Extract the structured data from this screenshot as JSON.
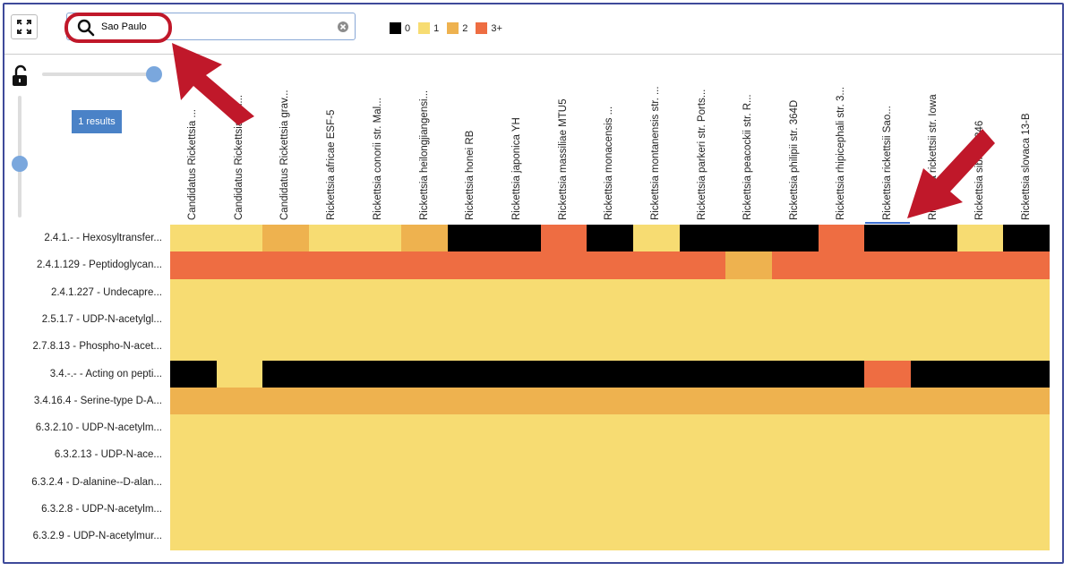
{
  "search": {
    "value": "Sao Paulo"
  },
  "legend": [
    {
      "label": "0",
      "color": "#000000"
    },
    {
      "label": "1",
      "color": "#f7dc72"
    },
    {
      "label": "2",
      "color": "#eeb24f"
    },
    {
      "label": "3+",
      "color": "#ee6d42"
    }
  ],
  "results_badge": "1 results",
  "columns": [
    "Candidatus Rickettsia ...",
    "Candidatus Rickettsia am...",
    "Candidatus Rickettsia grav...",
    "Rickettsia africae ESF-5",
    "Rickettsia conorii str. Mal...",
    "Rickettsia heilongjiangensi...",
    "Rickettsia honei RB",
    "Rickettsia japonica YH",
    "Rickettsia massiliae MTU5",
    "Rickettsia monacensis ...",
    "Rickettsia montanensis str. ...",
    "Rickettsia parkeri str. Ports...",
    "Rickettsia peacockii str. R...",
    "Rickettsia philipii str. 364D",
    "Rickettsia rhipicephali str. 3...",
    "Rickettsia rickettsii Sao...",
    "Rickettsia rickettsii str. Iowa",
    "Rickettsia sibirica 246",
    "Rickettsia slovaca 13-B"
  ],
  "rows": [
    {
      "label": "2.4.1.- - Hexosyltransfer...",
      "values": [
        1,
        1,
        2,
        1,
        1,
        2,
        0,
        0,
        3,
        0,
        1,
        0,
        0,
        0,
        3,
        0,
        0,
        1,
        0
      ]
    },
    {
      "label": "2.4.1.129 - Peptidoglycan...",
      "values": [
        3,
        3,
        3,
        3,
        3,
        3,
        3,
        3,
        3,
        3,
        3,
        3,
        2,
        3,
        3,
        3,
        3,
        3,
        3
      ]
    },
    {
      "label": "2.4.1.227 - Undecapre...",
      "values": [
        1,
        1,
        1,
        1,
        1,
        1,
        1,
        1,
        1,
        1,
        1,
        1,
        1,
        1,
        1,
        1,
        1,
        1,
        1
      ]
    },
    {
      "label": "2.5.1.7 - UDP-N-acetylgl...",
      "values": [
        1,
        1,
        1,
        1,
        1,
        1,
        1,
        1,
        1,
        1,
        1,
        1,
        1,
        1,
        1,
        1,
        1,
        1,
        1
      ]
    },
    {
      "label": "2.7.8.13 - Phospho-N-acet...",
      "values": [
        1,
        1,
        1,
        1,
        1,
        1,
        1,
        1,
        1,
        1,
        1,
        1,
        1,
        1,
        1,
        1,
        1,
        1,
        1
      ]
    },
    {
      "label": "3.4.-.- - Acting on pepti...",
      "values": [
        0,
        1,
        0,
        0,
        0,
        0,
        0,
        0,
        0,
        0,
        0,
        0,
        0,
        0,
        0,
        3,
        0,
        0,
        0
      ]
    },
    {
      "label": "3.4.16.4 - Serine-type D-A...",
      "values": [
        2,
        2,
        2,
        2,
        2,
        2,
        2,
        2,
        2,
        2,
        2,
        2,
        2,
        2,
        2,
        2,
        2,
        2,
        2
      ]
    },
    {
      "label": "6.3.2.10 - UDP-N-acetylm...",
      "values": [
        1,
        1,
        1,
        1,
        1,
        1,
        1,
        1,
        1,
        1,
        1,
        1,
        1,
        1,
        1,
        1,
        1,
        1,
        1
      ]
    },
    {
      "label": "6.3.2.13 - UDP-N-ace...",
      "values": [
        1,
        1,
        1,
        1,
        1,
        1,
        1,
        1,
        1,
        1,
        1,
        1,
        1,
        1,
        1,
        1,
        1,
        1,
        1
      ]
    },
    {
      "label": "6.3.2.4 - D-alanine--D-alan...",
      "values": [
        1,
        1,
        1,
        1,
        1,
        1,
        1,
        1,
        1,
        1,
        1,
        1,
        1,
        1,
        1,
        1,
        1,
        1,
        1
      ]
    },
    {
      "label": "6.3.2.8 - UDP-N-acetylm...",
      "values": [
        1,
        1,
        1,
        1,
        1,
        1,
        1,
        1,
        1,
        1,
        1,
        1,
        1,
        1,
        1,
        1,
        1,
        1,
        1
      ]
    },
    {
      "label": "6.3.2.9 - UDP-N-acetylmur...",
      "values": [
        1,
        1,
        1,
        1,
        1,
        1,
        1,
        1,
        1,
        1,
        1,
        1,
        1,
        1,
        1,
        1,
        1,
        1,
        1
      ]
    }
  ],
  "colors": {
    "accent": "#7aa7dd",
    "badge": "#4a82c7",
    "annotation": "#c0182a"
  }
}
